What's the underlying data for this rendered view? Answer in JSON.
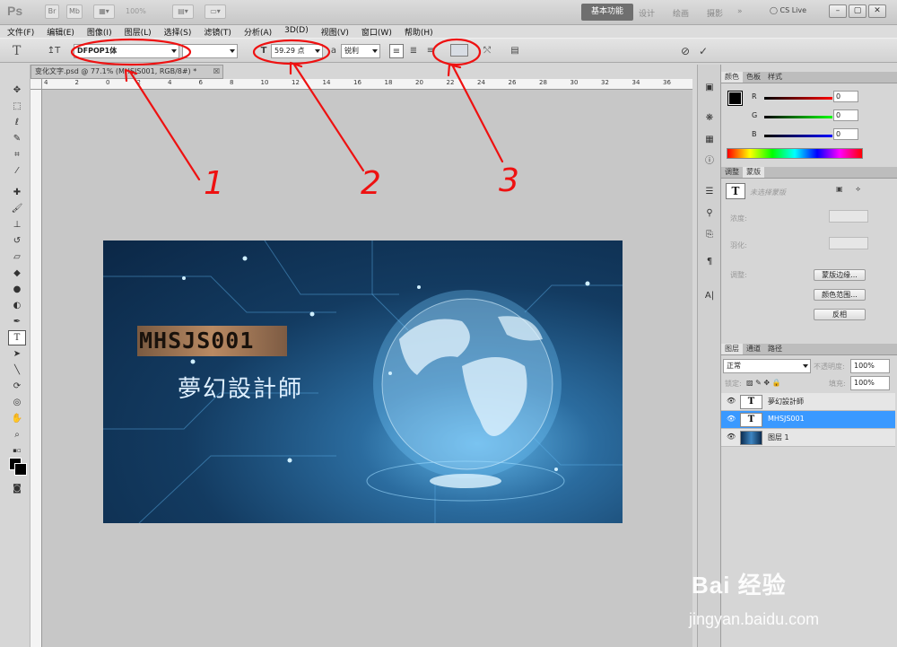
{
  "app": {
    "logo": "Ps",
    "zoom": "100%",
    "workspace_active": "基本功能",
    "workspaces": [
      "设计",
      "绘画",
      "摄影",
      "»"
    ],
    "cs_live": "CS Live",
    "window_controls": [
      "–",
      "▢",
      "✕"
    ]
  },
  "menu": [
    "文件(F)",
    "编辑(E)",
    "图像(I)",
    "图层(L)",
    "选择(S)",
    "滤镜(T)",
    "分析(A)",
    "3D(D)",
    "视图(V)",
    "窗口(W)",
    "帮助(H)"
  ],
  "options": {
    "tool_glyph": "T",
    "orient_glyph": "↥T",
    "font_family": "DFPOP1体",
    "font_size": "59.29 点",
    "antialias_label": "a",
    "antialias": "锐利",
    "text_color": "#d8dde4"
  },
  "document": {
    "tab_title": "变化文字.psd @ 77.1% (MHSJS001, RGB/8#) *",
    "ruler_ticks": [
      "4",
      "2",
      "0",
      "2",
      "4",
      "6",
      "8",
      "10",
      "12",
      "14",
      "16",
      "18",
      "20",
      "22",
      "24",
      "26",
      "28",
      "30",
      "32",
      "34",
      "36"
    ],
    "canvas_text_en": "MHSJS001",
    "canvas_text_cn": "夢幻設計師"
  },
  "annotations": [
    "1",
    "2",
    "3"
  ],
  "panels": {
    "color_tabs": [
      "颜色",
      "色板",
      "样式"
    ],
    "color_sliders": [
      {
        "label": "R",
        "value": "0"
      },
      {
        "label": "G",
        "value": "0"
      },
      {
        "label": "B",
        "value": "0"
      }
    ],
    "adjust_tabs": [
      "调整",
      "蒙版"
    ],
    "mask_placeholder": "未选择蒙版",
    "density_label": "浓度:",
    "feather_label": "羽化:",
    "refine_label": "调整:",
    "mask_buttons": [
      "蒙版边缘...",
      "颜色范围...",
      "反相"
    ],
    "layer_tabs": [
      "图层",
      "通道",
      "路径"
    ],
    "blend_mode": "正常",
    "opacity_label": "不透明度:",
    "opacity": "100%",
    "lock_label": "锁定:",
    "fill_label": "填充:",
    "fill": "100%",
    "layers": [
      {
        "name": "夢幻設計師",
        "type": "text",
        "selected": false
      },
      {
        "name": "MHSJS001",
        "type": "text",
        "selected": true
      },
      {
        "name": "图层 1",
        "type": "image",
        "selected": false
      }
    ]
  },
  "watermark": {
    "logo": "Bai 经验",
    "url": "jingyan.baidu.com"
  }
}
